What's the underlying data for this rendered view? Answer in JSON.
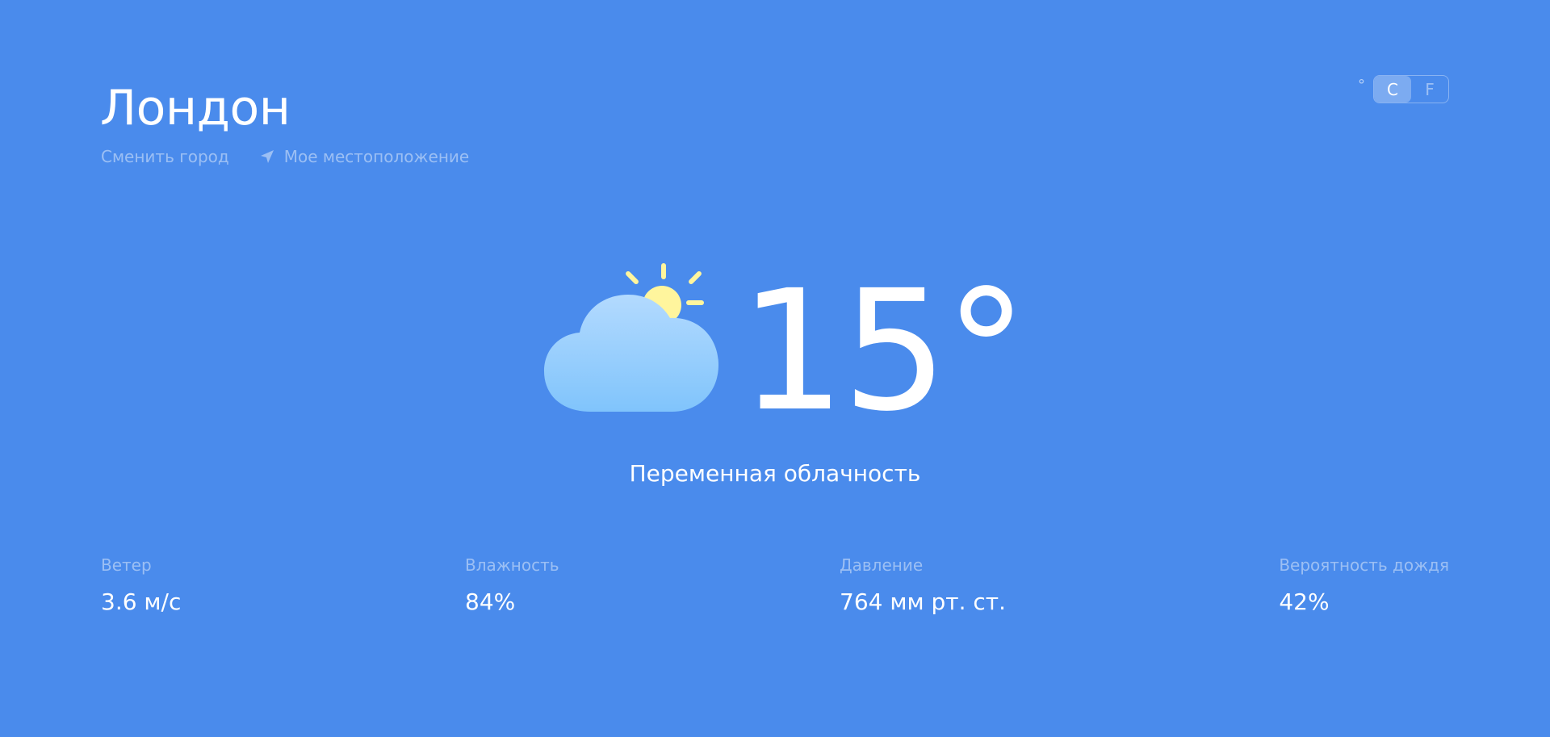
{
  "header": {
    "city": "Лондон",
    "change_city": "Сменить город",
    "my_location": "Мое местоположение"
  },
  "units": {
    "degree_symbol": "°",
    "celsius": "C",
    "fahrenheit": "F",
    "selected": "C"
  },
  "current": {
    "temperature": "15°",
    "condition": "Переменная облачность",
    "icon": "partly-cloudy-icon"
  },
  "stats": {
    "wind": {
      "label": "Ветер",
      "value": "3.6 м/с"
    },
    "humidity": {
      "label": "Влажность",
      "value": "84%"
    },
    "pressure": {
      "label": "Давление",
      "value": "764 мм рт. ст."
    },
    "rain": {
      "label": "Вероятность дождя",
      "value": "42%"
    }
  },
  "colors": {
    "background": "#4a8bec",
    "sun": "#fff59d",
    "cloud_top": "#b3dafe",
    "cloud_bottom": "#80c4fc"
  }
}
